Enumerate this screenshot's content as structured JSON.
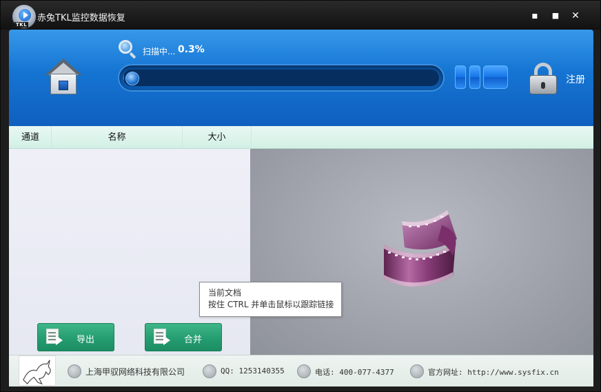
{
  "window": {
    "title": "赤兔TKL监控数据恢复",
    "logo_tag": "TKL",
    "minimize": "▪",
    "maximize": "■",
    "close": "✕"
  },
  "header": {
    "scan_label": "扫描中...",
    "scan_percent": "0.3%",
    "progress_fraction": 0.003,
    "register_label": "注册"
  },
  "columns": [
    "通道",
    "名称",
    "大小"
  ],
  "buttons": {
    "export_label": "导出",
    "merge_label": "合并"
  },
  "tooltip": {
    "line1": "当前文档",
    "line2": "按住 CTRL 并单击鼠标以跟踪链接"
  },
  "footer": {
    "company": "上海甲驭网络科技有限公司",
    "qq": "QQ: 1253140355",
    "phone": "电话: 400-077-4377",
    "website": "官方网址: http://www.sysfix.cn"
  },
  "colors": {
    "header_blue": "#1574d2",
    "button_green": "#249d70",
    "column_header": "#d3f0e5"
  },
  "icons": [
    "home-icon",
    "search-icon",
    "pause-icon",
    "stop-icon",
    "lock-icon",
    "export-icon",
    "merge-icon",
    "building-icon",
    "qq-icon",
    "phone-icon",
    "globe-icon",
    "film-reel-icon"
  ]
}
